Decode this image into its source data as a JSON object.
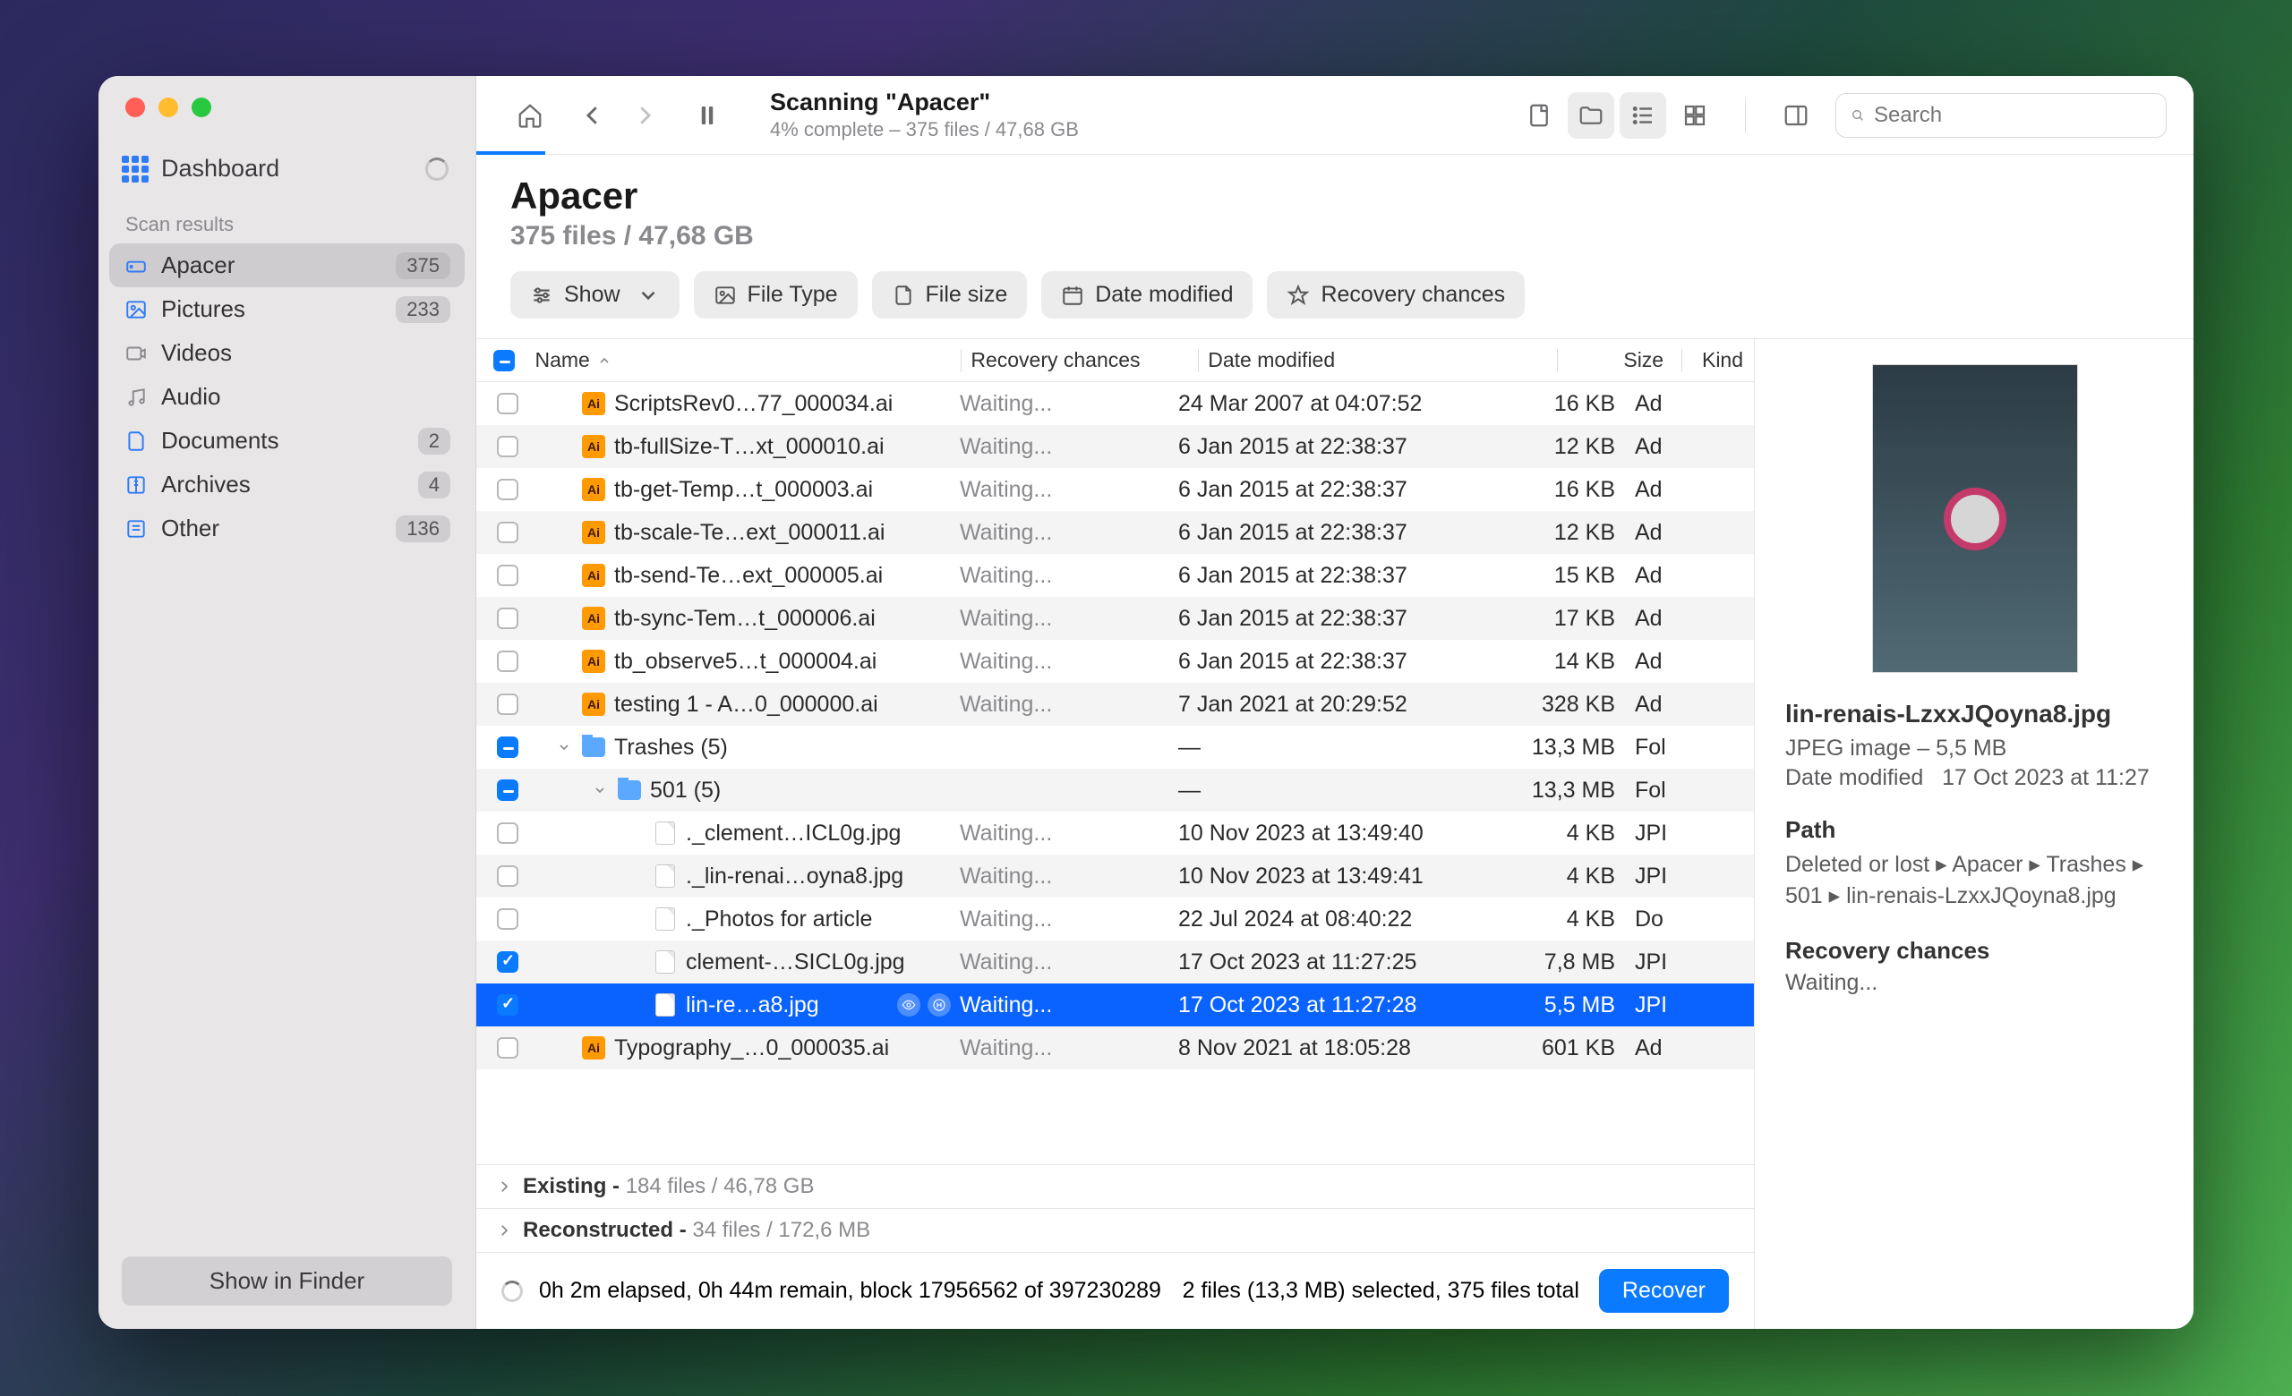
{
  "sidebar": {
    "dashboard": "Dashboard",
    "scan_results_header": "Scan results",
    "show_in_finder": "Show in Finder",
    "items": [
      {
        "label": "Apacer",
        "badge": "375",
        "active": true,
        "icon": "drive"
      },
      {
        "label": "Pictures",
        "badge": "233",
        "active": false,
        "icon": "image"
      },
      {
        "label": "Videos",
        "badge": "",
        "active": false,
        "icon": "video",
        "muted": true
      },
      {
        "label": "Audio",
        "badge": "",
        "active": false,
        "icon": "audio",
        "muted": true
      },
      {
        "label": "Documents",
        "badge": "2",
        "active": false,
        "icon": "doc"
      },
      {
        "label": "Archives",
        "badge": "4",
        "active": false,
        "icon": "archive"
      },
      {
        "label": "Other",
        "badge": "136",
        "active": false,
        "icon": "other"
      }
    ]
  },
  "toolbar": {
    "scan_title": "Scanning \"Apacer\"",
    "scan_sub": "4% complete – 375 files / 47,68 GB",
    "search_placeholder": "Search",
    "progress_percent": 4
  },
  "page_head": {
    "title": "Apacer",
    "subtitle": "375 files / 47,68 GB"
  },
  "filters": {
    "show": "Show",
    "file_type": "File Type",
    "file_size": "File size",
    "date_modified": "Date modified",
    "recovery": "Recovery chances"
  },
  "columns": {
    "name": "Name",
    "recovery": "Recovery chances",
    "date": "Date modified",
    "size": "Size",
    "kind": "Kind"
  },
  "rows": [
    {
      "check": "none",
      "indent": 1,
      "icon": "ai",
      "name": "ScriptsRev0…77_000034.ai",
      "rec": "Waiting...",
      "date": "24 Mar 2007 at 04:07:52",
      "size": "16 KB",
      "kind": "Ad"
    },
    {
      "check": "none",
      "indent": 1,
      "icon": "ai",
      "name": "tb-fullSize-T…xt_000010.ai",
      "rec": "Waiting...",
      "date": "6 Jan 2015 at 22:38:37",
      "size": "12 KB",
      "kind": "Ad"
    },
    {
      "check": "none",
      "indent": 1,
      "icon": "ai",
      "name": "tb-get-Temp…t_000003.ai",
      "rec": "Waiting...",
      "date": "6 Jan 2015 at 22:38:37",
      "size": "16 KB",
      "kind": "Ad"
    },
    {
      "check": "none",
      "indent": 1,
      "icon": "ai",
      "name": "tb-scale-Te…ext_000011.ai",
      "rec": "Waiting...",
      "date": "6 Jan 2015 at 22:38:37",
      "size": "12 KB",
      "kind": "Ad"
    },
    {
      "check": "none",
      "indent": 1,
      "icon": "ai",
      "name": "tb-send-Te…ext_000005.ai",
      "rec": "Waiting...",
      "date": "6 Jan 2015 at 22:38:37",
      "size": "15 KB",
      "kind": "Ad"
    },
    {
      "check": "none",
      "indent": 1,
      "icon": "ai",
      "name": "tb-sync-Tem…t_000006.ai",
      "rec": "Waiting...",
      "date": "6 Jan 2015 at 22:38:37",
      "size": "17 KB",
      "kind": "Ad"
    },
    {
      "check": "none",
      "indent": 1,
      "icon": "ai",
      "name": "tb_observe5…t_000004.ai",
      "rec": "Waiting...",
      "date": "6 Jan 2015 at 22:38:37",
      "size": "14 KB",
      "kind": "Ad"
    },
    {
      "check": "none",
      "indent": 1,
      "icon": "ai",
      "name": "testing 1 - A…0_000000.ai",
      "rec": "Waiting...",
      "date": "7 Jan 2021 at 20:29:52",
      "size": "328 KB",
      "kind": "Ad"
    },
    {
      "check": "dash",
      "indent": 1,
      "icon": "folder",
      "disclosure": "down",
      "name": "Trashes (5)",
      "rec": "",
      "date": "—",
      "size": "13,3 MB",
      "kind": "Fol"
    },
    {
      "check": "dash",
      "indent": 2,
      "icon": "folder",
      "disclosure": "down",
      "name": "501 (5)",
      "rec": "",
      "date": "—",
      "size": "13,3 MB",
      "kind": "Fol"
    },
    {
      "check": "none",
      "indent": 3,
      "icon": "doc",
      "name": "._clement…ICL0g.jpg",
      "rec": "Waiting...",
      "date": "10 Nov 2023 at 13:49:40",
      "size": "4 KB",
      "kind": "JPI"
    },
    {
      "check": "none",
      "indent": 3,
      "icon": "doc",
      "name": "._lin-renai…oyna8.jpg",
      "rec": "Waiting...",
      "date": "10 Nov 2023 at 13:49:41",
      "size": "4 KB",
      "kind": "JPI"
    },
    {
      "check": "none",
      "indent": 3,
      "icon": "doc",
      "name": "._Photos for article",
      "rec": "Waiting...",
      "date": "22 Jul 2024 at 08:40:22",
      "size": "4 KB",
      "kind": "Do"
    },
    {
      "check": "check",
      "indent": 3,
      "icon": "doc",
      "name": "clement-…SICL0g.jpg",
      "rec": "Waiting...",
      "date": "17 Oct 2023 at 11:27:25",
      "size": "7,8 MB",
      "kind": "JPI"
    },
    {
      "check": "check",
      "indent": 3,
      "icon": "doc",
      "name": "lin-re…a8.jpg",
      "rec": "Waiting...",
      "date": "17 Oct 2023 at 11:27:28",
      "size": "5,5 MB",
      "kind": "JPI",
      "selected": true,
      "quicklook": true
    },
    {
      "check": "none",
      "indent": 1,
      "icon": "ai",
      "name": "Typography_…0_000035.ai",
      "rec": "Waiting...",
      "date": "8 Nov 2021 at 18:05:28",
      "size": "601 KB",
      "kind": "Ad"
    }
  ],
  "summary": {
    "existing_label": "Existing - ",
    "existing_value": "184 files / 46,78 GB",
    "reconstructed_label": "Reconstructed - ",
    "reconstructed_value": "34 files / 172,6 MB"
  },
  "details": {
    "name": "lin-renais-LzxxJQoyna8.jpg",
    "meta": "JPEG image – 5,5 MB",
    "date_label": "Date modified",
    "date_value": "17 Oct 2023 at 11:27",
    "path_header": "Path",
    "path_value": "Deleted or lost ▸ Apacer ▸ Trashes ▸ 501 ▸ lin-renais-LzxxJQoyna8.jpg",
    "recovery_header": "Recovery chances",
    "recovery_value": "Waiting..."
  },
  "status": {
    "elapsed": "0h 2m elapsed, 0h 44m remain, block 17956562 of 397230289",
    "selection": "2 files (13,3 MB) selected, 375 files total",
    "recover": "Recover"
  }
}
